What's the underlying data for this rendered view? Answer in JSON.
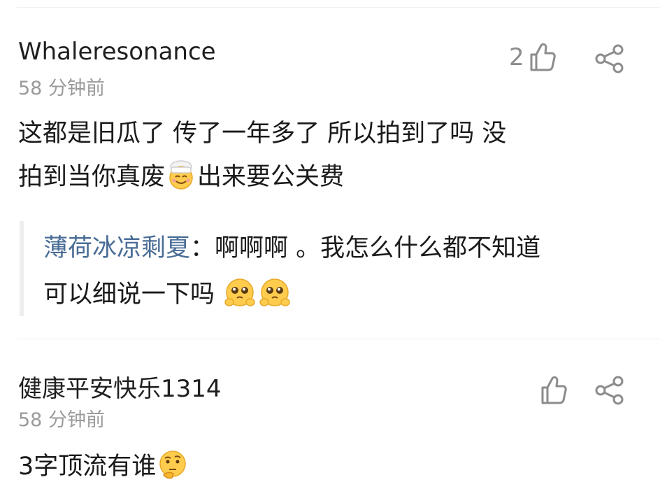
{
  "comments": [
    {
      "username": "Whaleresonance",
      "time": "58 分钟前",
      "like_count": "2",
      "text_line1": "这都是旧瓜了 传了一年多了 所以拍到了吗 没",
      "text_line2_a": "拍到当你真废",
      "text_line2_b": "出来要公关费",
      "reply": {
        "name": "薄荷冰凉剩夏",
        "sep": "：",
        "line1": "啊啊啊 。我怎么什么都不知道",
        "line2": "可以细说一下吗 "
      }
    },
    {
      "username": "健康平安快乐1314",
      "time": "58 分钟前",
      "like_count": "",
      "text": "3字顶流有谁"
    }
  ],
  "icons": {
    "like": "thumbs-up-outline-icon",
    "share": "share-icon",
    "emoji_chef": "chef-smile-emoji",
    "emoji_pleading": "pleading-face-emoji",
    "emoji_thinking": "thinking-face-emoji"
  },
  "colors": {
    "reply_name": "#4a6d96",
    "meta": "#9a9a9a",
    "icon": "#8c8c8c"
  }
}
